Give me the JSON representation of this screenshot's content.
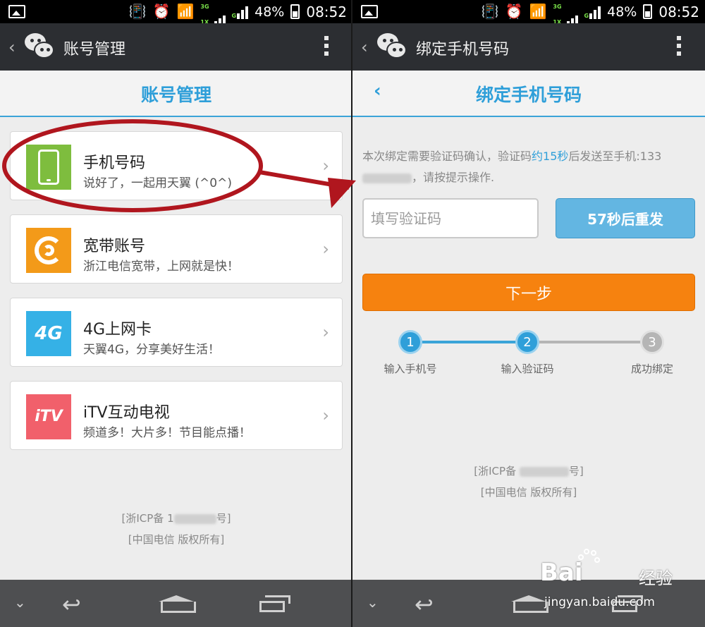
{
  "status_bar": {
    "battery": "48%",
    "time": "08:52",
    "net_tags": [
      "3G",
      "1X",
      "G"
    ]
  },
  "left": {
    "topbar_title": "账号管理",
    "page_title": "账号管理",
    "items": [
      {
        "title": "手机号码",
        "subtitle": "说好了，一起用天翼 (^0^)",
        "icon": "mobile-phone-icon"
      },
      {
        "title": "宽带账号",
        "subtitle": "浙江电信宽带，上网就是快！",
        "icon": "broadband-swirl-icon"
      },
      {
        "title": "4G上网卡",
        "subtitle": "天翼4G，分享美好生活！",
        "icon": "4g-icon",
        "icon_text": "4G"
      },
      {
        "title": "iTV互动电视",
        "subtitle": "频道多！大片多！节目能点播！",
        "icon": "itv-icon",
        "icon_text": "iTV"
      }
    ],
    "footer_icp_prefix": "[浙ICP备 1",
    "footer_icp_suffix": "号]",
    "footer_copyright": "[中国电信 版权所有]"
  },
  "right": {
    "topbar_title": "绑定手机号码",
    "page_title": "绑定手机号码",
    "description_pre": "本次绑定需要验证码确认，验证码",
    "description_highlight": "约15秒",
    "description_post": "后发送至手机:133",
    "description_tail": "，请按提示操作.",
    "code_placeholder": "填写验证码",
    "resend_label": "57秒后重发",
    "next_label": "下一步",
    "steps": [
      {
        "num": "1",
        "label": "输入手机号",
        "state": "done"
      },
      {
        "num": "2",
        "label": "输入验证码",
        "state": "done"
      },
      {
        "num": "3",
        "label": "成功绑定",
        "state": "todo"
      }
    ],
    "footer_icp_prefix": "[浙ICP备",
    "footer_icp_suffix": "号]",
    "footer_copyright": "[中国电信 版权所有]"
  },
  "watermark": {
    "brand": "Bai",
    "brand_cn": "经验",
    "url": "jingyan.baidu.com"
  },
  "colors": {
    "accent": "#2f9fd9",
    "orange": "#f6820f",
    "annotation": "#b0161e"
  }
}
